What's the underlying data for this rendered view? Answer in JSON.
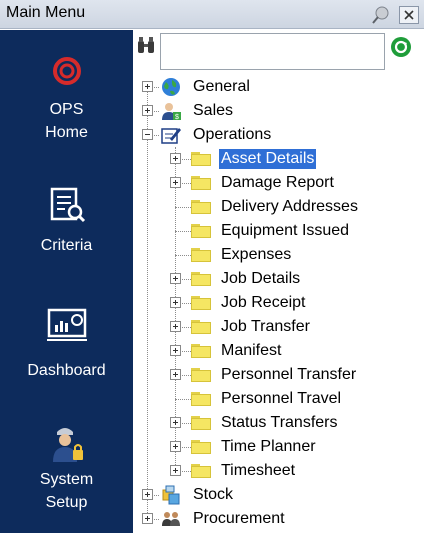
{
  "window": {
    "title": "Main Menu"
  },
  "sidebar": {
    "items": [
      {
        "label_line1": "OPS",
        "label_line2": "Home",
        "icon": "ops-home-icon"
      },
      {
        "label_line1": "Criteria",
        "label_line2": "",
        "icon": "criteria-icon"
      },
      {
        "label_line1": "Dashboard",
        "label_line2": "",
        "icon": "dashboard-icon"
      },
      {
        "label_line1": "System",
        "label_line2": "Setup",
        "icon": "system-setup-icon"
      }
    ]
  },
  "search": {
    "value": "",
    "placeholder": ""
  },
  "tree": {
    "general": "General",
    "sales": "Sales",
    "operations": "Operations",
    "operations_children": [
      "Asset Details",
      "Damage Report",
      "Delivery Addresses",
      "Equipment Issued",
      "Expenses",
      "Job Details",
      "Job Receipt",
      "Job Transfer",
      "Manifest",
      "Personnel Transfer",
      "Personnel Travel",
      "Status Transfers",
      "Time Planner",
      "Timesheet"
    ],
    "stock": "Stock",
    "procurement": "Procurement"
  },
  "selected_node": "Asset Details",
  "colors": {
    "sidebar": "#0d2b5c",
    "selection": "#2f6fd6",
    "ops_logo": "#d62b2b"
  }
}
